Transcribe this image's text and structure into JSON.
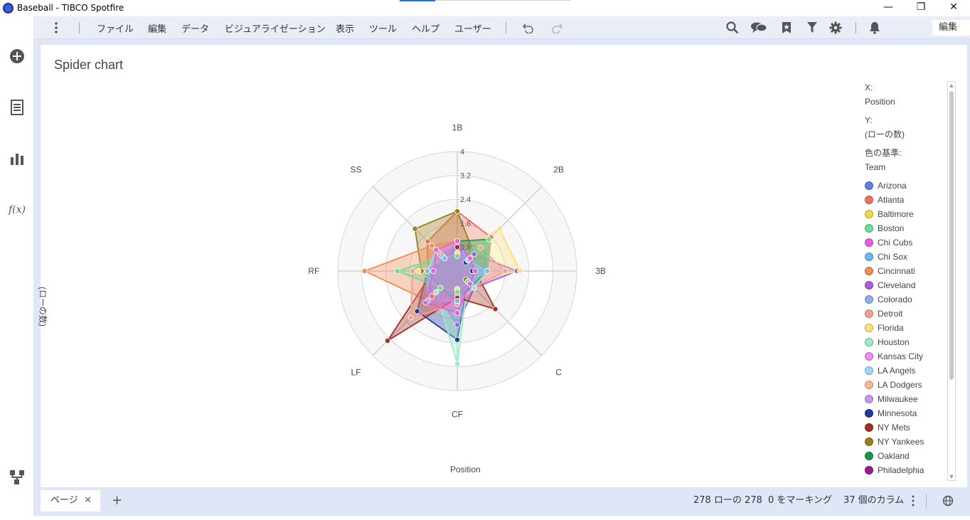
{
  "window": {
    "title": "Baseball - TIBCO Spotfire",
    "minimize": "—",
    "restore": "❐",
    "close": "✕"
  },
  "sidebar": {
    "items": [
      {
        "name": "add-icon"
      },
      {
        "name": "data-table-icon"
      },
      {
        "name": "visualization-icon"
      },
      {
        "name": "expression-icon",
        "label": "f(x)"
      },
      {
        "name": "data-canvas-icon"
      }
    ]
  },
  "menubar": {
    "items": [
      "ファイル",
      "編集",
      "データ",
      "ビジュアライゼーション",
      "表示",
      "ツール",
      "ヘルプ",
      "ユーザー"
    ],
    "mode": "編集"
  },
  "visualization": {
    "title": "Spider chart",
    "y_axis_title": "(ローの数)",
    "x_axis_title": "Position"
  },
  "legend": {
    "x_label": "X:",
    "x_value": "Position",
    "y_label": "Y:",
    "y_value": "(ローの数)",
    "color_label": "色の基準:",
    "color_value": "Team",
    "teams": [
      {
        "name": "Arizona",
        "color": "#5b7fe8"
      },
      {
        "name": "Atlanta",
        "color": "#f07060"
      },
      {
        "name": "Baltimore",
        "color": "#f5d445"
      },
      {
        "name": "Boston",
        "color": "#6cde9a"
      },
      {
        "name": "Chi Cubs",
        "color": "#e85ee0"
      },
      {
        "name": "Chi Sox",
        "color": "#6ab8ea"
      },
      {
        "name": "Cincinnati",
        "color": "#f58c52"
      },
      {
        "name": "Cleveland",
        "color": "#a65fe0"
      },
      {
        "name": "Colorado",
        "color": "#8fb0ee"
      },
      {
        "name": "Detroit",
        "color": "#f4a090"
      },
      {
        "name": "Florida",
        "color": "#fbe07a"
      },
      {
        "name": "Houston",
        "color": "#98f0c0"
      },
      {
        "name": "Kansas City",
        "color": "#f28cec"
      },
      {
        "name": "LA Angels",
        "color": "#9fd8f5"
      },
      {
        "name": "LA Dodgers",
        "color": "#f8b890"
      },
      {
        "name": "Milwaukee",
        "color": "#c59af0"
      },
      {
        "name": "Minnesota",
        "color": "#1f3a9c"
      },
      {
        "name": "NY Mets",
        "color": "#a32f22"
      },
      {
        "name": "NY Yankees",
        "color": "#9a7e1c"
      },
      {
        "name": "Oakland",
        "color": "#1f9650"
      },
      {
        "name": "Philadelphia",
        "color": "#9a1c8a"
      }
    ]
  },
  "chart_data": {
    "type": "radar",
    "axes": [
      "1B",
      "2B",
      "3B",
      "C",
      "CF",
      "LF",
      "RF",
      "SS"
    ],
    "rlim": [
      0,
      4
    ],
    "ticks": [
      "0.8",
      "1.6",
      "2.4",
      "3.2",
      "4"
    ],
    "grid": true,
    "series": [
      {
        "name": "Atlanta",
        "color": "#f07060",
        "values": [
          2.0,
          1.6,
          1.0,
          0.8,
          0.9,
          1.2,
          1.0,
          1.4
        ]
      },
      {
        "name": "NY Yankees",
        "color": "#9a7e1c",
        "values": [
          2.0,
          0.8,
          0.6,
          0.4,
          0.6,
          1.0,
          1.2,
          2.0
        ]
      },
      {
        "name": "Cincinnati",
        "color": "#f58c52",
        "values": [
          1.0,
          0.6,
          0.5,
          0.5,
          0.8,
          1.4,
          3.1,
          1.2
        ]
      },
      {
        "name": "Minnesota",
        "color": "#1f3a9c",
        "values": [
          0.6,
          0.4,
          0.5,
          0.5,
          2.3,
          1.9,
          1.0,
          0.6
        ]
      },
      {
        "name": "Cleveland",
        "color": "#a65fe0",
        "values": [
          0.8,
          0.8,
          2.0,
          0.8,
          1.8,
          1.0,
          1.0,
          0.8
        ]
      },
      {
        "name": "Houston",
        "color": "#98f0c0",
        "values": [
          0.6,
          0.5,
          0.6,
          0.5,
          3.1,
          1.0,
          1.0,
          0.6
        ]
      },
      {
        "name": "Florida",
        "color": "#fbe07a",
        "values": [
          0.6,
          2.0,
          2.1,
          0.5,
          0.6,
          0.8,
          1.3,
          0.6
        ]
      },
      {
        "name": "NY Mets",
        "color": "#a32f22",
        "values": [
          0.8,
          0.6,
          0.6,
          1.8,
          0.9,
          3.3,
          0.8,
          0.6
        ]
      },
      {
        "name": "Detroit",
        "color": "#f4a090",
        "values": [
          1.0,
          1.1,
          1.6,
          0.8,
          1.1,
          2.2,
          1.5,
          0.9
        ]
      },
      {
        "name": "Oakland",
        "color": "#1f9650",
        "values": [
          1.0,
          1.5,
          1.0,
          0.7,
          1.0,
          0.8,
          1.0,
          0.6
        ]
      },
      {
        "name": "Boston",
        "color": "#6cde9a",
        "values": [
          0.5,
          1.5,
          1.0,
          0.5,
          0.7,
          0.8,
          2.0,
          0.7
        ]
      },
      {
        "name": "LA Angels",
        "color": "#9fd8f5",
        "values": [
          1.0,
          0.5,
          1.0,
          0.8,
          1.0,
          1.4,
          1.0,
          1.0
        ]
      },
      {
        "name": "Colorado",
        "color": "#8fb0ee",
        "values": [
          1.0,
          0.6,
          1.0,
          0.6,
          1.0,
          1.4,
          1.0,
          0.6
        ]
      },
      {
        "name": "Chi Cubs",
        "color": "#e85ee0",
        "values": [
          1.0,
          0.6,
          0.6,
          0.6,
          1.4,
          1.5,
          0.8,
          1.0
        ]
      }
    ]
  },
  "status": {
    "page_tab": "ページ",
    "page_close": "✕",
    "add_page": "+",
    "rows": "278 ローの 278",
    "marked": "0 をマーキング",
    "columns": "37 個のカラム"
  }
}
